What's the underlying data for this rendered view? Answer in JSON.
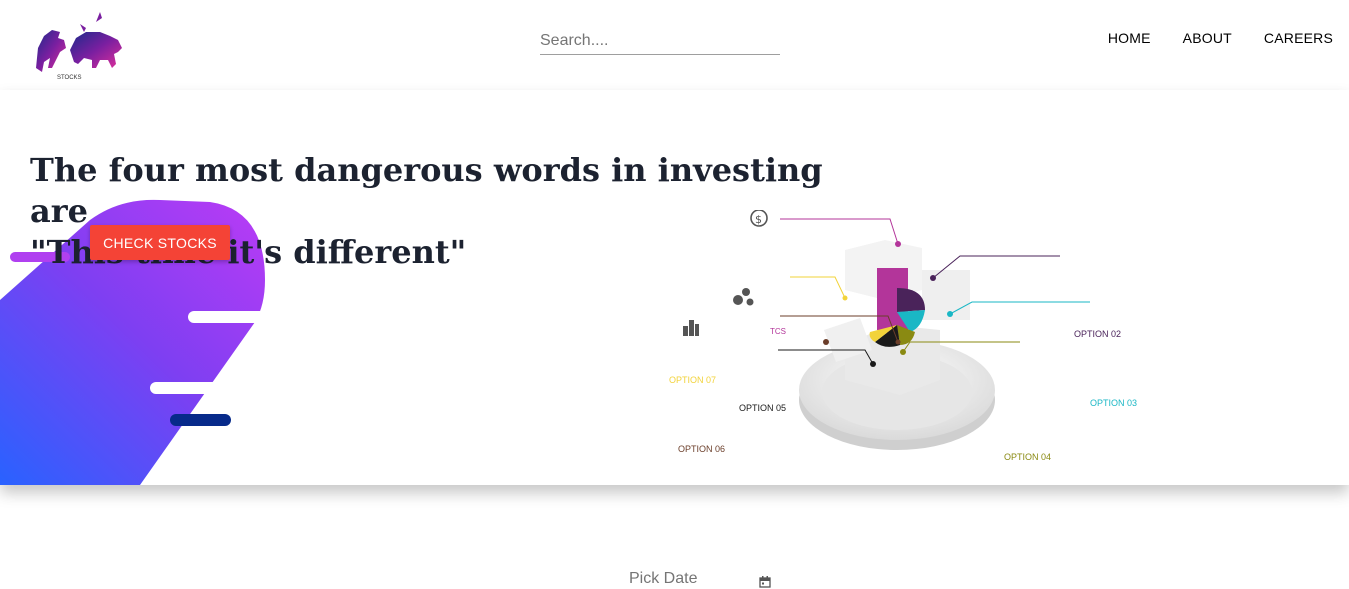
{
  "header": {
    "logo_icon": "bull-and-bear-logo-icon",
    "logo_caption": "STOCKS",
    "search": {
      "placeholder": "Search....",
      "value": ""
    },
    "nav": {
      "home": "HOME",
      "about": "ABOUT",
      "careers": "CAREERS"
    }
  },
  "hero": {
    "quote_line1": "The four most dangerous words in investing are",
    "quote_line2": "\"This time it's different\"",
    "cta_label": "CHECK STOCKS",
    "infographic": {
      "labels": {
        "tcs": "TCS",
        "opt2": "OPTION 02",
        "opt3": "OPTION 03",
        "opt4": "OPTION 04",
        "opt5": "OPTION 05",
        "opt6": "OPTION 06",
        "opt7": "OPTION 07"
      },
      "icons": [
        "dollar-coin-icon",
        "gears-people-icon",
        "buildings-icon"
      ]
    }
  },
  "date_picker": {
    "placeholder": "Pick Date",
    "value": "",
    "icon": "calendar-icon"
  },
  "colors": {
    "accent": "#f44336",
    "nav_text": "#000000",
    "blob_gradient": [
      "#2962ff",
      "#7e3ff2",
      "#b53cf5"
    ],
    "option_colors": [
      "#b3359a",
      "#4a235a",
      "#1ab7c5",
      "#8a8a12",
      "#1a1a1a",
      "#6b3e2a",
      "#f2d33a"
    ]
  }
}
